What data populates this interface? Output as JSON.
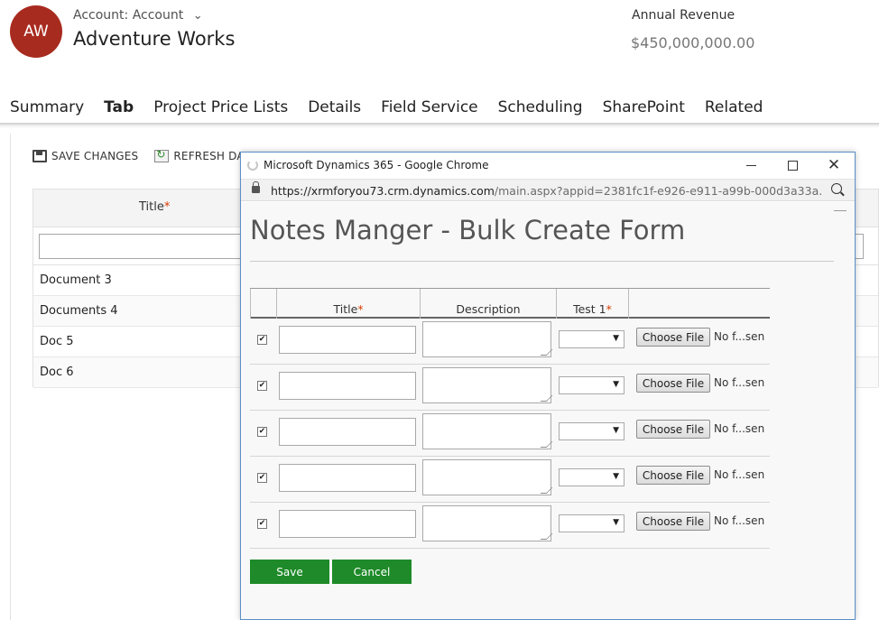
{
  "header": {
    "avatar_initials": "AW",
    "entity_type": "Account: Account",
    "record_name": "Adventure Works",
    "field_label": "Annual Revenue",
    "field_value": "$450,000,000.00"
  },
  "tabs": [
    {
      "label": "Summary",
      "active": false
    },
    {
      "label": "Tab",
      "active": true
    },
    {
      "label": "Project Price Lists",
      "active": false
    },
    {
      "label": "Details",
      "active": false
    },
    {
      "label": "Field Service",
      "active": false
    },
    {
      "label": "Scheduling",
      "active": false
    },
    {
      "label": "SharePoint",
      "active": false
    },
    {
      "label": "Related",
      "active": false
    }
  ],
  "subgrid": {
    "commands": {
      "save": "SAVE CHANGES",
      "refresh": "REFRESH DAT"
    },
    "title_header": "Title",
    "required_marker": "*",
    "rows": [
      "Document 3",
      "Documents 4",
      "Doc 5",
      "Doc 6"
    ]
  },
  "popup": {
    "window_title": "Microsoft Dynamics 365 - Google Chrome",
    "url_host": "https://xrmforyou73.crm.dynamics.com",
    "url_path": "/main.aspx?appid=2381fc1f-e926-e911-a99b-000d3a33a...",
    "form_title": "Notes Manger - Bulk Create Form",
    "columns": {
      "title": "Title",
      "description": "Description",
      "test1": "Test 1",
      "required_marker": "*"
    },
    "rows": [
      {
        "checked": true,
        "file_button": "Choose File",
        "file_status": "No f...sen"
      },
      {
        "checked": true,
        "file_button": "Choose File",
        "file_status": "No f...sen"
      },
      {
        "checked": true,
        "file_button": "Choose File",
        "file_status": "No f...sen"
      },
      {
        "checked": true,
        "file_button": "Choose File",
        "file_status": "No f...sen"
      },
      {
        "checked": true,
        "file_button": "Choose File",
        "file_status": "No f...sen"
      }
    ],
    "buttons": {
      "save": "Save",
      "cancel": "Cancel"
    },
    "colors": {
      "accent_button": "#1e8a29",
      "avatar": "#a82b1f",
      "tab_underline": "#1160b7",
      "required": "#d83b01"
    }
  }
}
